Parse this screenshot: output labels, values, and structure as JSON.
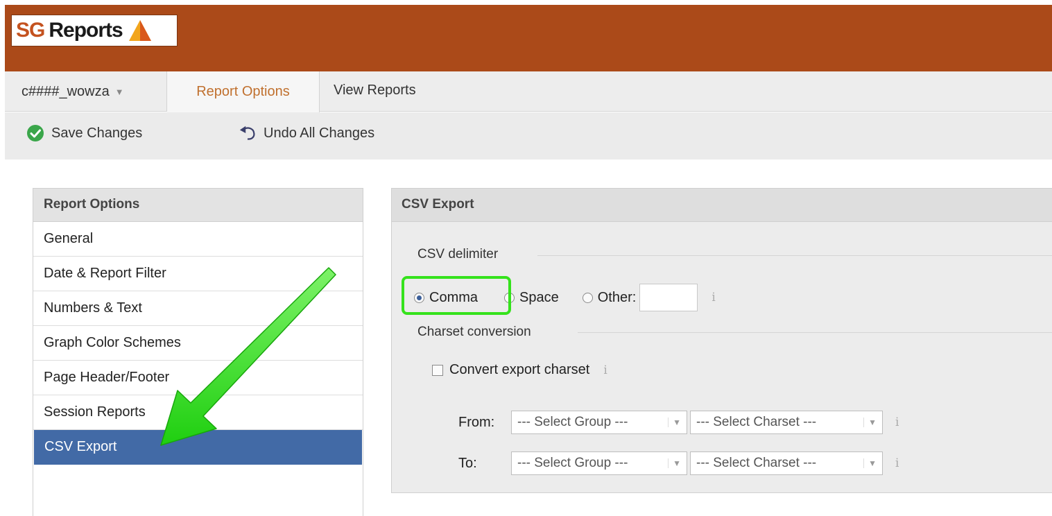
{
  "app": {
    "logo_text_1": "SG",
    "logo_text_2": "Reports",
    "brand_color": "#ab4a19"
  },
  "tabs": {
    "account_label": "c####_wowza",
    "active_label": "Report Options",
    "view_label": "View Reports"
  },
  "toolbar": {
    "save_label": "Save Changes",
    "undo_label": "Undo All Changes",
    "save_icon": "check-circle-icon",
    "undo_icon": "undo-arrow-icon"
  },
  "sidebar": {
    "title": "Report Options",
    "items": [
      {
        "label": "General"
      },
      {
        "label": "Date & Report Filter"
      },
      {
        "label": "Numbers & Text"
      },
      {
        "label": "Graph Color Schemes"
      },
      {
        "label": "Page Header/Footer"
      },
      {
        "label": "Session Reports"
      },
      {
        "label": "CSV Export"
      }
    ],
    "active_index": 6,
    "active_color": "#426aa6"
  },
  "panel": {
    "title": "CSV Export",
    "delimiter_legend": "CSV delimiter",
    "delimiter_options": [
      "Comma",
      "Space",
      "Other:"
    ],
    "selected_delimiter": "Comma",
    "other_value": "",
    "charset_legend": "Charset conversion",
    "convert_label": "Convert export charset",
    "convert_checked": false,
    "from_label": "From:",
    "to_label": "To:",
    "group_placeholder": "--- Select Group ---",
    "charset_placeholder": "--- Select Charset ---",
    "info_glyph": "i"
  },
  "annotation": {
    "highlight_color": "#35e21c",
    "arrow_color": "#2ee016"
  }
}
